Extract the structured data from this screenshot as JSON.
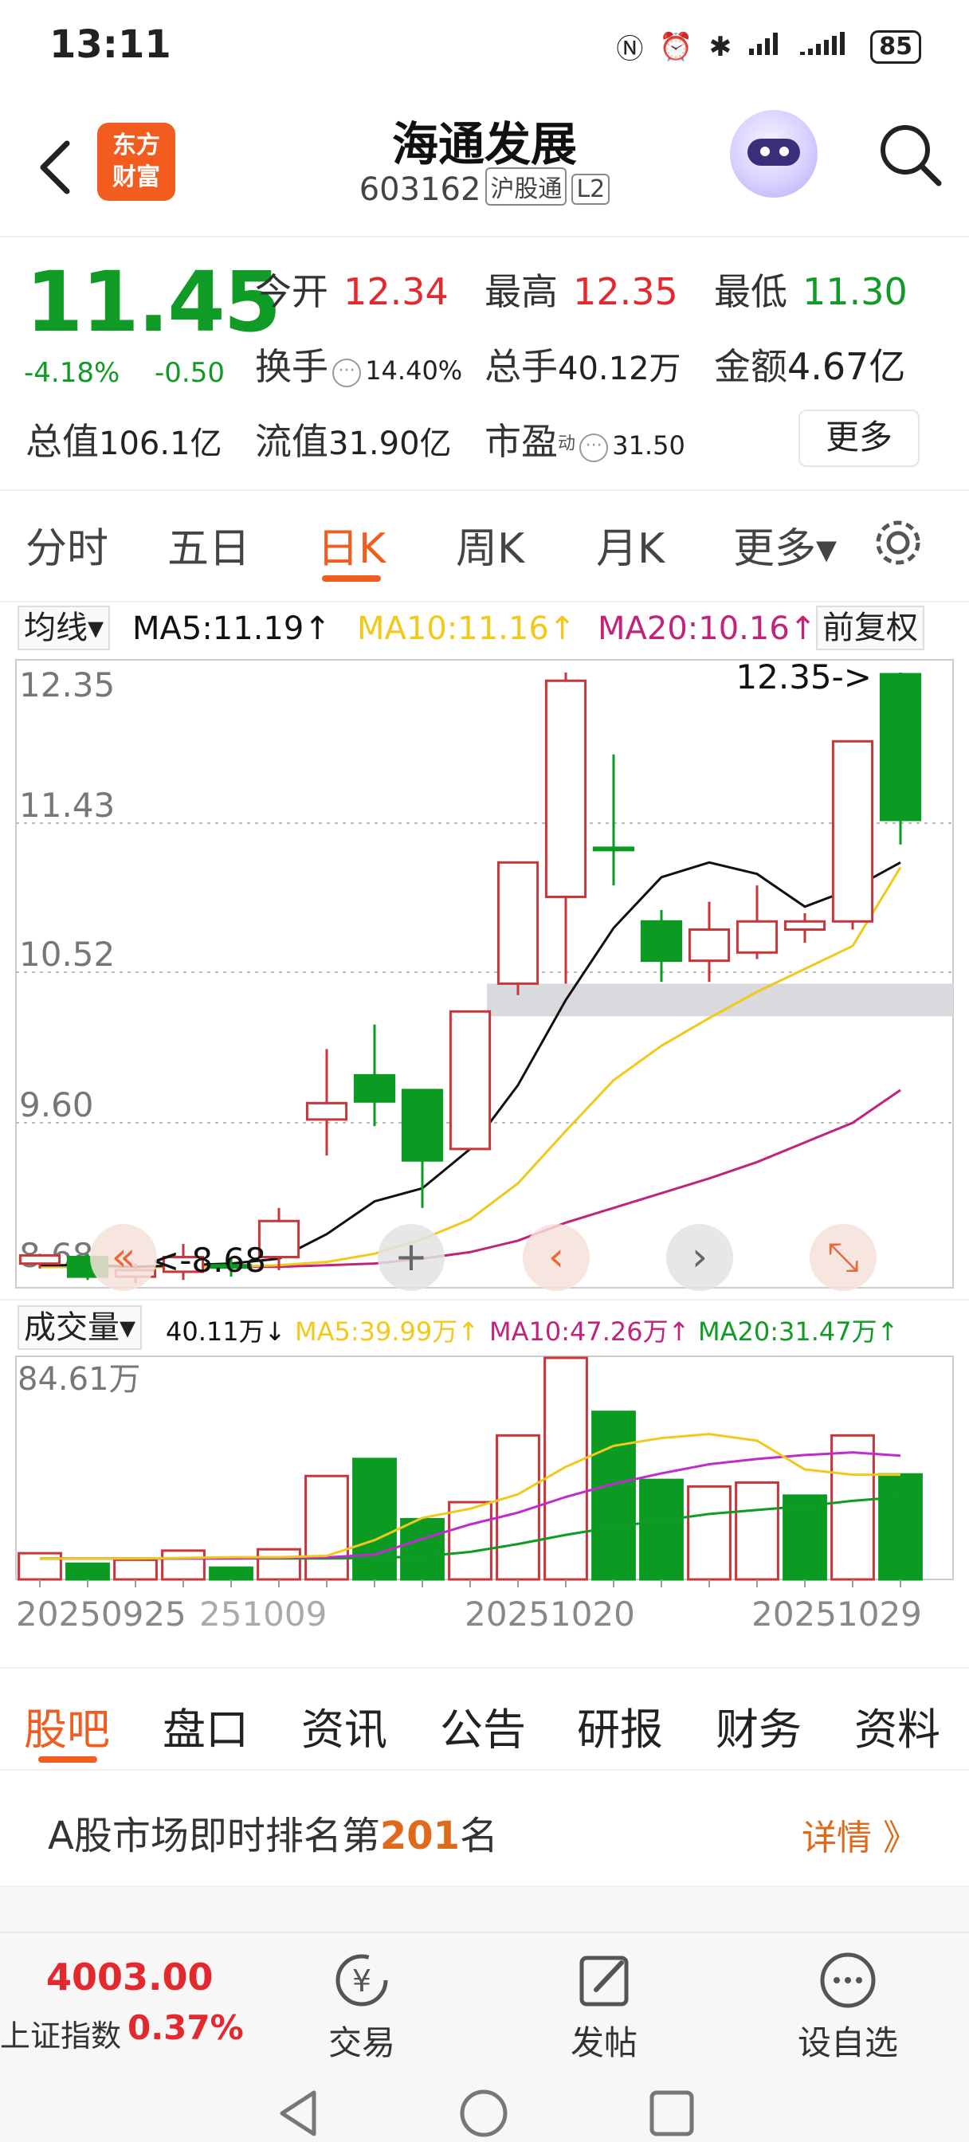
{
  "status_bar": {
    "time": "13:11",
    "battery": "85"
  },
  "header": {
    "logo_line1": "东方",
    "logo_line2": "财富",
    "title": "海通发展",
    "code": "603162",
    "tag_connect": "沪股通",
    "tag_level": "L2"
  },
  "quote": {
    "price": "11.45",
    "change_pct": "-4.18%",
    "change": "-0.50",
    "open_label": "今开",
    "open": "12.34",
    "high_label": "最高",
    "high": "12.35",
    "low_label": "最低",
    "low": "11.30",
    "turnover_label": "换手",
    "turnover": "14.40%",
    "volume_label": "总手",
    "volume": "40.12万",
    "amount_label": "金额",
    "amount": "4.67亿",
    "mcap_label": "总值",
    "mcap": "106.1亿",
    "float_label": "流值",
    "float_cap": "31.90亿",
    "pe_label": "市盈",
    "pe_sup": "动",
    "pe": "31.50",
    "more_button": "更多"
  },
  "period_tabs": [
    {
      "label": "分时"
    },
    {
      "label": "五日"
    },
    {
      "label": "日K"
    },
    {
      "label": "周K"
    },
    {
      "label": "月K"
    },
    {
      "label": "更多▾"
    }
  ],
  "ma_row": {
    "dropdown": "均线▾",
    "ma5": "MA5:11.19↑",
    "ma10": "MA10:11.16↑",
    "ma20": "MA20:10.16↑",
    "adjust": "前复权",
    "colors": {
      "ma5": "#111111",
      "ma10": "#f2c81b",
      "ma20": "#c2237a"
    }
  },
  "chart_data": [
    {
      "type": "candlestick",
      "y_tick_labels": [
        "12.35",
        "11.43",
        "10.52",
        "9.60",
        "8.68"
      ],
      "ylim": [
        8.68,
        12.35
      ],
      "max_marker": "12.35->",
      "min_marker": "<-8.68",
      "candles": [
        {
          "o": 8.74,
          "c": 8.79,
          "h": 8.8,
          "l": 8.71,
          "dir": "up"
        },
        {
          "o": 8.78,
          "c": 8.66,
          "h": 8.8,
          "l": 8.64,
          "dir": "down"
        },
        {
          "o": 8.66,
          "c": 8.7,
          "h": 8.74,
          "l": 8.62,
          "dir": "up"
        },
        {
          "o": 8.69,
          "c": 8.78,
          "h": 8.86,
          "l": 8.64,
          "dir": "up"
        },
        {
          "o": 8.73,
          "c": 8.72,
          "h": 8.78,
          "l": 8.66,
          "dir": "down"
        },
        {
          "o": 8.78,
          "c": 9.0,
          "h": 9.08,
          "l": 8.7,
          "dir": "up"
        },
        {
          "o": 9.62,
          "c": 9.72,
          "h": 10.05,
          "l": 9.4,
          "dir": "up"
        },
        {
          "o": 9.89,
          "c": 9.73,
          "h": 10.2,
          "l": 9.58,
          "dir": "down"
        },
        {
          "o": 9.8,
          "c": 9.37,
          "h": 9.8,
          "l": 9.08,
          "dir": "down"
        },
        {
          "o": 9.44,
          "c": 10.28,
          "h": 10.28,
          "l": 9.44,
          "dir": "up"
        },
        {
          "o": 10.45,
          "c": 11.19,
          "h": 11.19,
          "l": 10.38,
          "dir": "up"
        },
        {
          "o": 10.98,
          "c": 12.3,
          "h": 12.35,
          "l": 10.45,
          "dir": "up"
        },
        {
          "o": 11.28,
          "c": 11.28,
          "h": 11.85,
          "l": 11.05,
          "dir": "down"
        },
        {
          "o": 10.83,
          "c": 10.59,
          "h": 10.9,
          "l": 10.46,
          "dir": "down"
        },
        {
          "o": 10.59,
          "c": 10.78,
          "h": 10.95,
          "l": 10.46,
          "dir": "up"
        },
        {
          "o": 10.64,
          "c": 10.83,
          "h": 11.05,
          "l": 10.6,
          "dir": "up"
        },
        {
          "o": 10.78,
          "c": 10.83,
          "h": 10.88,
          "l": 10.7,
          "dir": "up"
        },
        {
          "o": 10.83,
          "c": 11.93,
          "h": 11.93,
          "l": 10.78,
          "dir": "up"
        },
        {
          "o": 12.34,
          "c": 11.45,
          "h": 12.35,
          "l": 11.3,
          "dir": "down"
        }
      ],
      "ma5": [
        8.73,
        8.73,
        8.72,
        8.73,
        8.74,
        8.77,
        8.92,
        9.12,
        9.2,
        9.44,
        9.83,
        10.35,
        10.79,
        11.1,
        11.19,
        11.12,
        10.92,
        11.03,
        11.19
      ],
      "ma10": [
        8.72,
        8.72,
        8.72,
        8.72,
        8.72,
        8.73,
        8.75,
        8.8,
        8.89,
        9.01,
        9.23,
        9.55,
        9.86,
        10.07,
        10.24,
        10.4,
        10.54,
        10.68,
        11.16
      ],
      "ma20": [
        8.72,
        8.72,
        8.72,
        8.72,
        8.72,
        8.72,
        8.73,
        8.74,
        8.77,
        8.81,
        8.88,
        8.99,
        9.08,
        9.17,
        9.26,
        9.36,
        9.48,
        9.6,
        9.8
      ]
    },
    {
      "type": "volume",
      "label": "成交量▾",
      "current": "40.11万↓",
      "ma5_label": "MA5:39.99万↑",
      "ma10_label": "MA10:47.26万↑",
      "ma20_label": "MA20:31.47万↑",
      "y_max_label": "84.61万",
      "ylim": [
        0,
        84.61
      ],
      "values": [
        10.0,
        6.0,
        7.5,
        11.0,
        4.5,
        11.5,
        39.5,
        46.0,
        23.0,
        29.5,
        55.0,
        84.61,
        64.0,
        38.0,
        35.5,
        37.0,
        32.0,
        55.0,
        40.11
      ],
      "dirs": [
        "up",
        "down",
        "up",
        "up",
        "down",
        "up",
        "up",
        "down",
        "down",
        "up",
        "up",
        "up",
        "down",
        "down",
        "up",
        "up",
        "down",
        "up",
        "down"
      ],
      "ma5": [
        8.0,
        8.0,
        8.0,
        8.2,
        8.5,
        8.5,
        9.0,
        15.0,
        23.5,
        27.0,
        32.5,
        43.0,
        51.0,
        54.0,
        55.5,
        53.0,
        42.0,
        40.0,
        39.99
      ],
      "ma10": [
        8.0,
        8.0,
        8.0,
        8.0,
        8.0,
        8.2,
        8.4,
        9.5,
        15.5,
        21.0,
        25.5,
        31.5,
        36.5,
        40.5,
        44.0,
        46.0,
        47.5,
        48.5,
        47.26
      ],
      "ma20": [
        8.0,
        8.0,
        8.0,
        8.0,
        8.0,
        8.0,
        8.0,
        8.2,
        8.8,
        10.5,
        13.5,
        17.0,
        20.0,
        22.5,
        25.0,
        26.5,
        28.0,
        30.0,
        31.47
      ],
      "date_labels": [
        "20250925",
        "251009",
        "20251020",
        "20251029"
      ]
    }
  ],
  "chart_controls": {
    "zoom_in": "+",
    "prev": "‹",
    "next": "›"
  },
  "bottom_tabs": [
    {
      "label": "股吧"
    },
    {
      "label": "盘口"
    },
    {
      "label": "资讯"
    },
    {
      "label": "公告"
    },
    {
      "label": "研报"
    },
    {
      "label": "财务"
    },
    {
      "label": "资料"
    }
  ],
  "rank": {
    "prefix": "A股市场即时排名第",
    "number": "201",
    "suffix": "名",
    "details": "详情 》"
  },
  "bottom_bar": {
    "index_value": "4003.00",
    "index_name": "上证指数",
    "index_pct": "0.37%",
    "trade": "交易",
    "post": "发帖",
    "watchlist": "设自选"
  }
}
